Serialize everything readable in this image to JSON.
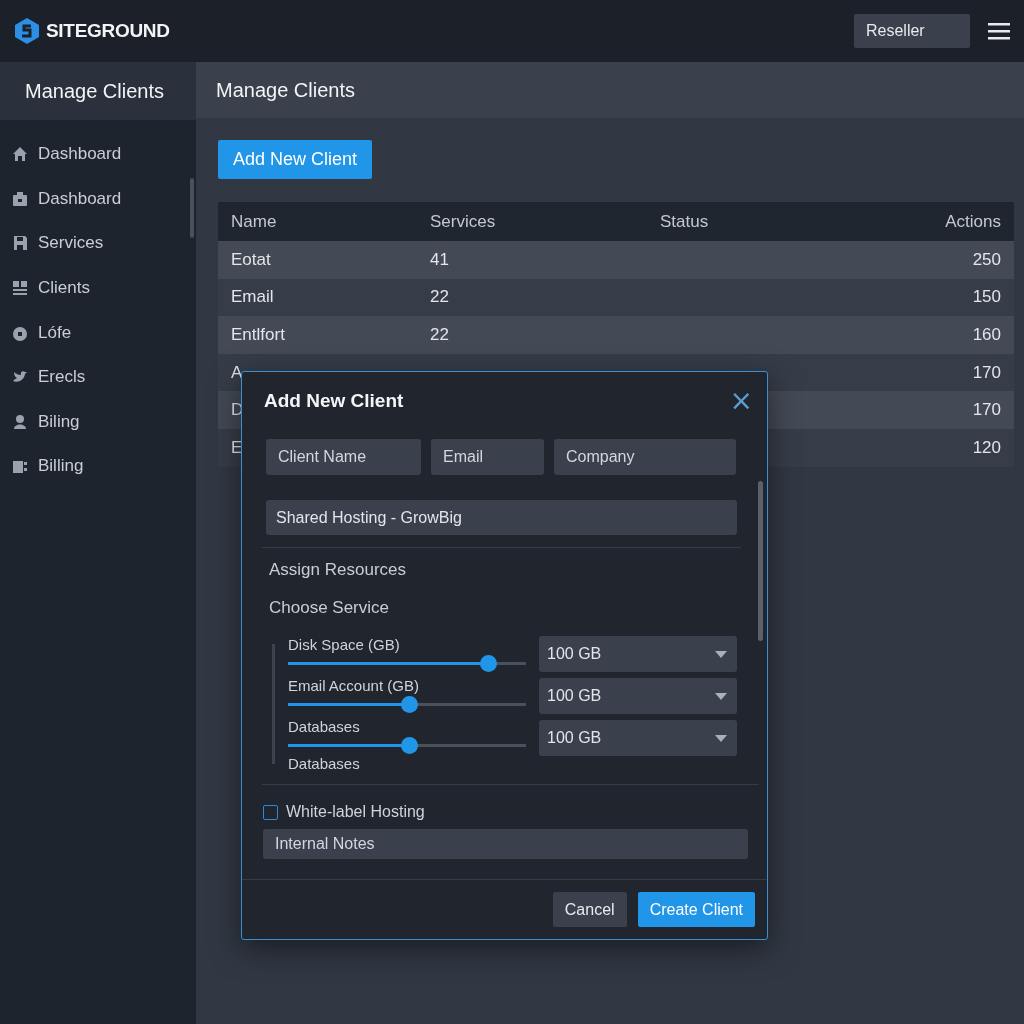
{
  "header": {
    "brand": "SITEGROUND",
    "account_button": "Reseller"
  },
  "sidebar": {
    "title": "Manage Clients",
    "items": [
      {
        "label": "Dashboard"
      },
      {
        "label": "Dashboard"
      },
      {
        "label": "Services"
      },
      {
        "label": "Clients"
      },
      {
        "label": "Lófe"
      },
      {
        "label": "Erecls"
      },
      {
        "label": "Biling"
      },
      {
        "label": "Billing"
      }
    ]
  },
  "page": {
    "title": "Manage Clients",
    "add_button": "Add New Client"
  },
  "table": {
    "columns": [
      "Name",
      "Services",
      "Status",
      "Actions"
    ],
    "rows": [
      {
        "name": "Eotat",
        "services": "41",
        "actions": "250"
      },
      {
        "name": "Email",
        "services": "22",
        "actions": "150"
      },
      {
        "name": "Entlfort",
        "services": "22",
        "actions": "160"
      },
      {
        "name": "A",
        "actions": "170"
      },
      {
        "name": "D",
        "actions": "170"
      },
      {
        "name": "E",
        "actions": "120"
      }
    ]
  },
  "modal": {
    "title": "Add New Client",
    "close": "×",
    "fields": [
      {
        "placeholder": "Client Name"
      },
      {
        "placeholder": "Email"
      },
      {
        "placeholder": "Company"
      }
    ],
    "plan": "Shared Hosting - GrowBig",
    "section": "Assign Resources",
    "subsection": "Choose Service",
    "resources": [
      {
        "label": "Disk Space (GB)",
        "level": 0.84,
        "value": "100 GB"
      },
      {
        "label": "Email Account (GB)",
        "level": 0.51,
        "value": "100 GB"
      },
      {
        "label": "Databases",
        "level": 0.51,
        "value": "100 GB"
      }
    ],
    "resources_footer": "Databases",
    "white_label": {
      "label": "White-label Hosting",
      "checked": false
    },
    "notes": {
      "placeholder": "Internal Notes"
    },
    "buttons": [
      {
        "label": "Cancel",
        "kind": "secondary"
      },
      {
        "label": "Create Client",
        "kind": "primary"
      }
    ]
  }
}
